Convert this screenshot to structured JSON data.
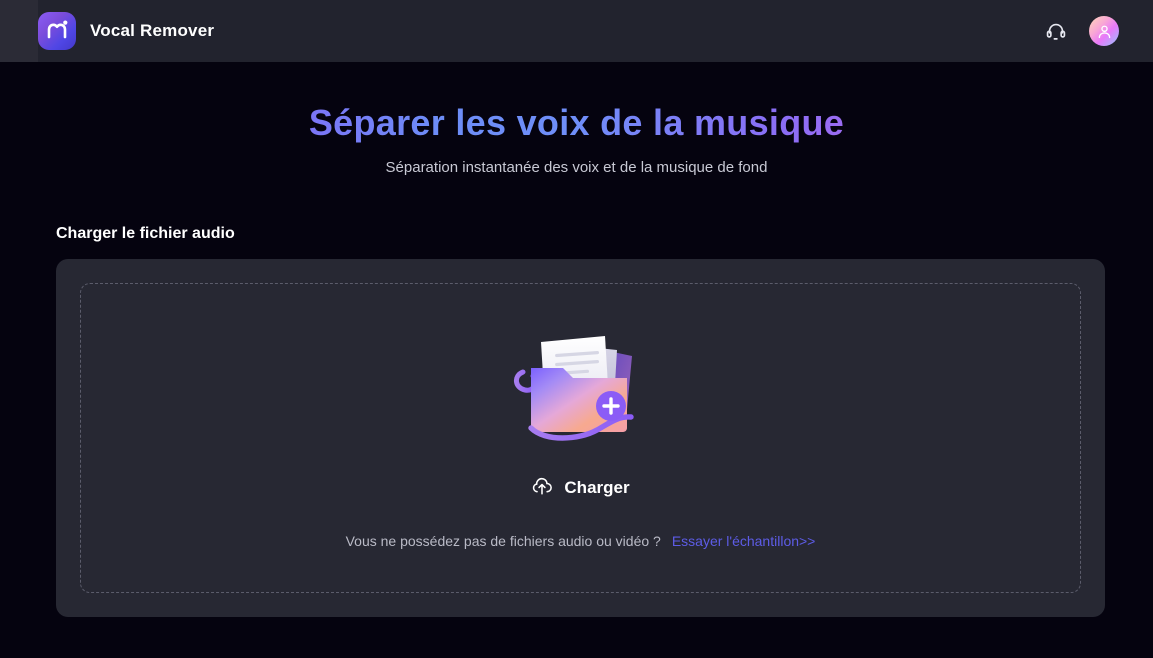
{
  "header": {
    "brand_name": "Vocal Remover",
    "logo_icon": "mi-logo-icon",
    "support_icon": "headset-icon",
    "avatar_icon": "user-avatar-icon"
  },
  "hero": {
    "title": "Séparer les voix de la musique",
    "subtitle": "Séparation instantanée des voix et de la musique de fond",
    "title_gradient": [
      "#a855f7",
      "#6d8df7",
      "#d86fe0"
    ]
  },
  "upload_section": {
    "section_title": "Charger le fichier audio",
    "illustration_icon": "folder-add-files-illustration",
    "upload_icon": "cloud-upload-icon",
    "upload_label": "Charger",
    "hint_text": "Vous ne possédez pas de fichiers audio ou vidéo ?",
    "sample_link_label": "Essayer l'échantillon>>",
    "sample_link_color": "#5d5ce6"
  },
  "theme": {
    "page_background": "#05030f",
    "header_background": "#22232e",
    "card_background": "#272833",
    "dashed_border": "#5b5c6b",
    "accent": "#8b5cf6"
  }
}
